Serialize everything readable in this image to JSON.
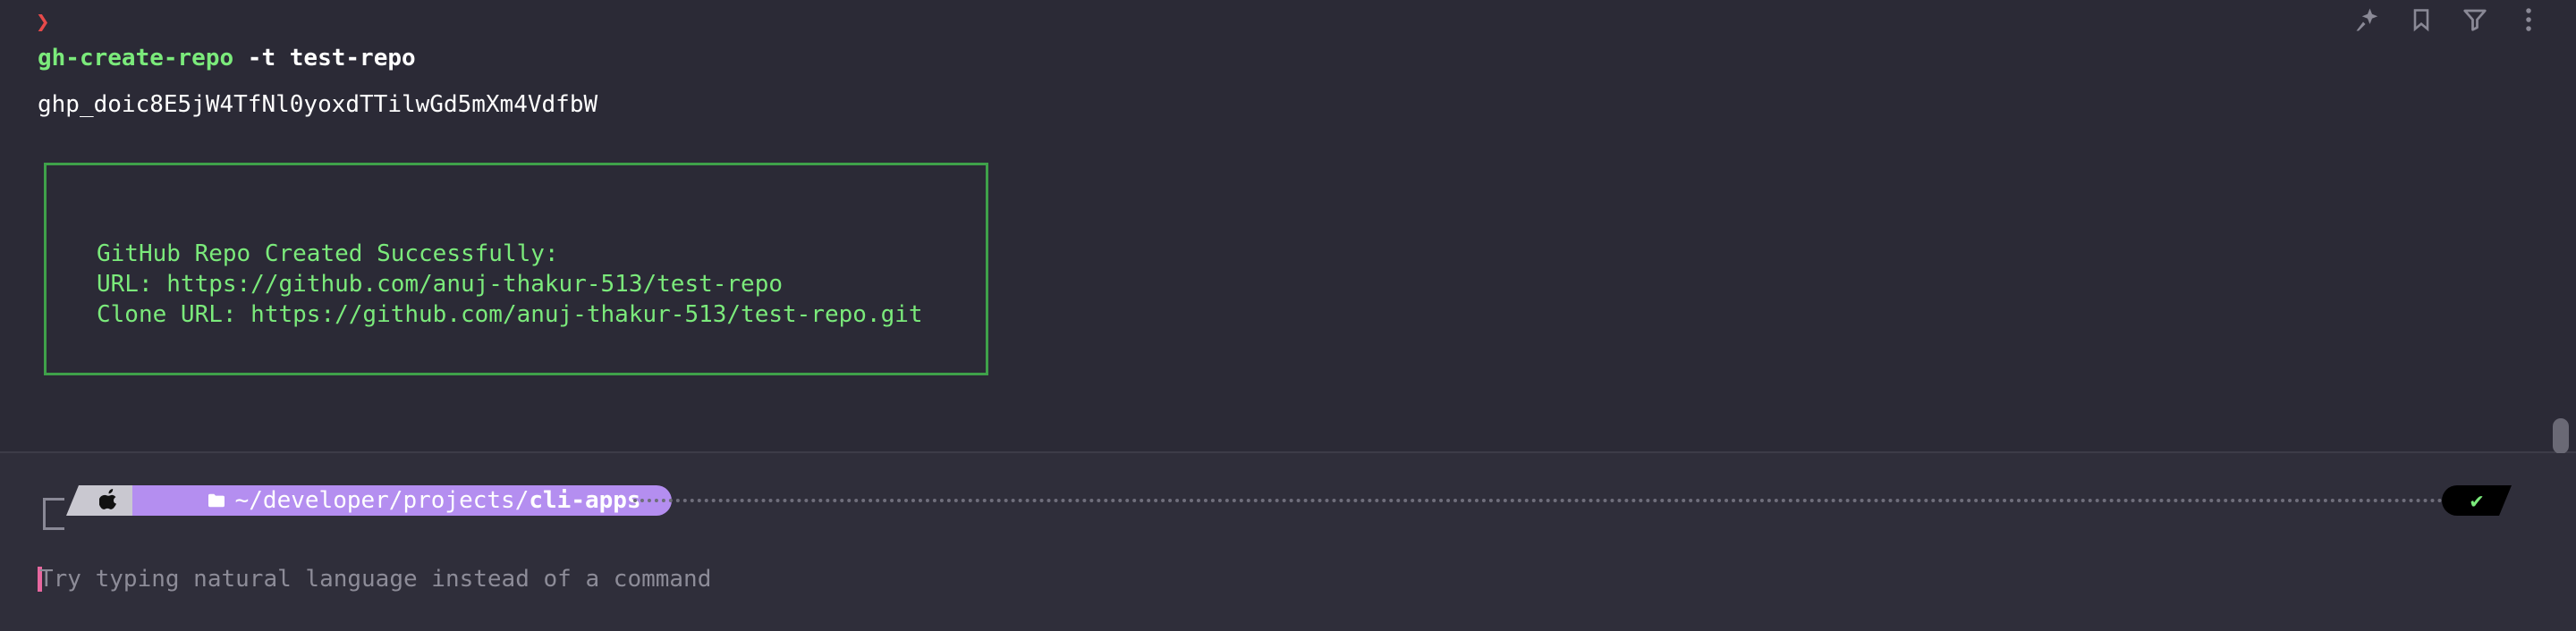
{
  "block": {
    "prompt_symbol": "❯",
    "command_name": "gh-create-repo",
    "command_args": " -t test-repo",
    "output_token": "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",
    "box_lines": [
      "GitHub Repo Created Successfully:",
      "URL: https://github.com/anuj-thakur-513/test-repo",
      "Clone URL: https://github.com/anuj-thakur-513/test-repo.git"
    ]
  },
  "toolbar": {
    "icons": [
      "sparkle-pin-icon",
      "bookmark-icon",
      "filter-icon",
      "more-vertical-icon"
    ]
  },
  "prompt": {
    "os_icon": "apple-icon",
    "folder_icon": "folder-icon",
    "path_prefix": "~/developer/projects/",
    "path_current": "cli-apps",
    "status_symbol": "✔"
  },
  "input": {
    "placeholder": "Try typing natural language instead of a command"
  },
  "colors": {
    "background": "#2b2a36",
    "command_green": "#7bea7b",
    "box_border": "#3fa14a",
    "path_segment": "#b48ef0",
    "cursor": "#e8679f",
    "prompt_red": "#e74a4a"
  }
}
